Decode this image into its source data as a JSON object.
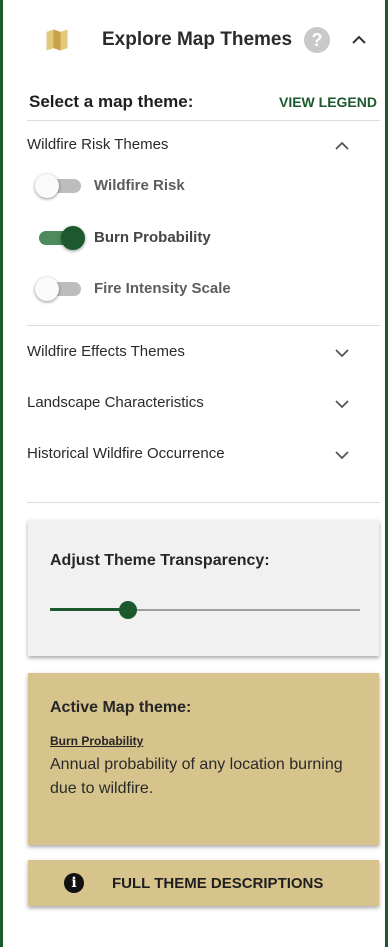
{
  "header": {
    "title": "Explore Map Themes",
    "icon": "map-icon",
    "help_glyph": "?"
  },
  "select": {
    "label": "Select a map theme:",
    "legend_link": "VIEW LEGEND"
  },
  "sections": {
    "wildfire_risk": {
      "label": "Wildfire Risk Themes",
      "expanded": true,
      "toggles": [
        {
          "label": "Wildfire Risk",
          "on": false
        },
        {
          "label": "Burn Probability",
          "on": true
        },
        {
          "label": "Fire Intensity Scale",
          "on": false
        }
      ]
    },
    "wildfire_effects": {
      "label": "Wildfire Effects Themes",
      "expanded": false
    },
    "landscape": {
      "label": "Landscape Characteristics",
      "expanded": false
    },
    "historical": {
      "label": "Historical Wildfire Occurrence",
      "expanded": false
    }
  },
  "transparency": {
    "title": "Adjust Theme Transparency:",
    "value_fraction": 0.25
  },
  "active_theme": {
    "title": "Active Map theme:",
    "name": "Burn Probability",
    "description": "Annual probability of any location burning due to wildfire."
  },
  "descriptions_button": {
    "label": "FULL THEME DESCRIPTIONS",
    "info_glyph": "i"
  },
  "colors": {
    "brand_green": "#1c5a2e",
    "tan": "#d7c48c",
    "icon_gold": "#c9a24a"
  }
}
